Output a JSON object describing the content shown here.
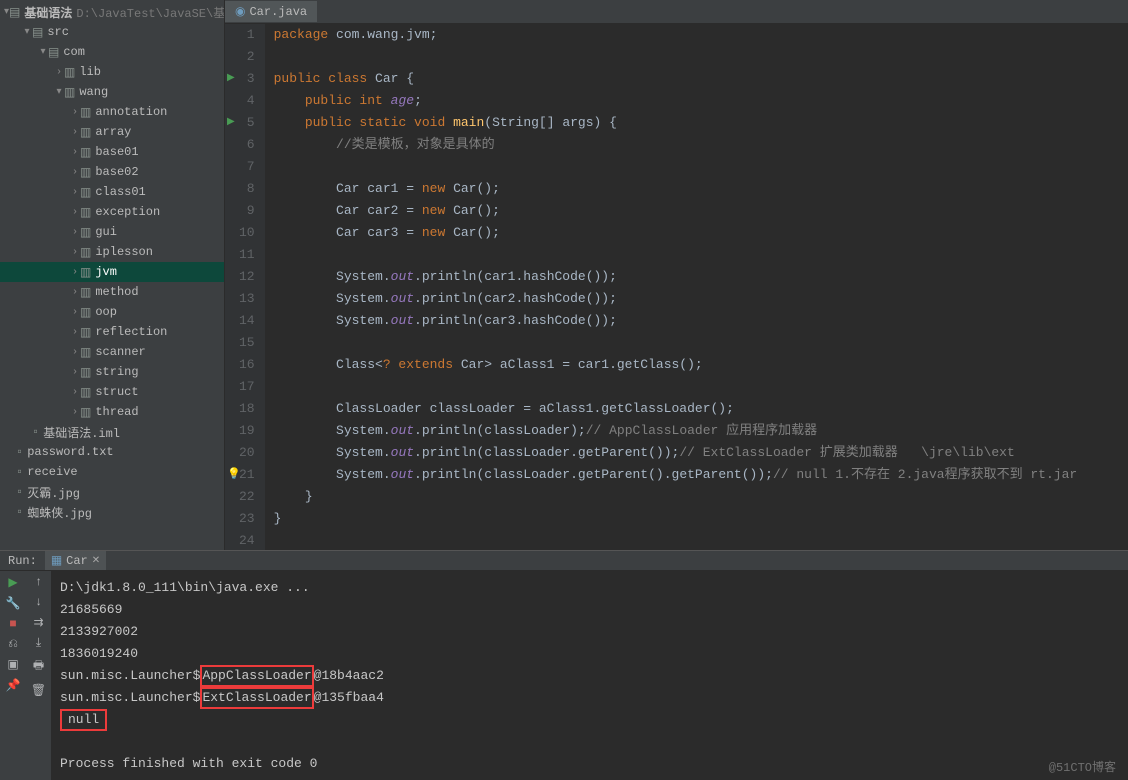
{
  "sidebar": {
    "root": {
      "name": "基础语法",
      "path": "D:\\JavaTest\\JavaSE\\基"
    },
    "items": [
      {
        "indent": 1,
        "arrow": "▾",
        "icon": "folder",
        "label": "src"
      },
      {
        "indent": 2,
        "arrow": "▾",
        "icon": "folder",
        "label": "com"
      },
      {
        "indent": 3,
        "arrow": "›",
        "icon": "package",
        "label": "lib"
      },
      {
        "indent": 3,
        "arrow": "▾",
        "icon": "package",
        "label": "wang"
      },
      {
        "indent": 4,
        "arrow": "›",
        "icon": "package",
        "label": "annotation"
      },
      {
        "indent": 4,
        "arrow": "›",
        "icon": "package",
        "label": "array"
      },
      {
        "indent": 4,
        "arrow": "›",
        "icon": "package",
        "label": "base01"
      },
      {
        "indent": 4,
        "arrow": "›",
        "icon": "package",
        "label": "base02"
      },
      {
        "indent": 4,
        "arrow": "›",
        "icon": "package",
        "label": "class01"
      },
      {
        "indent": 4,
        "arrow": "›",
        "icon": "package",
        "label": "exception"
      },
      {
        "indent": 4,
        "arrow": "›",
        "icon": "package",
        "label": "gui"
      },
      {
        "indent": 4,
        "arrow": "›",
        "icon": "package",
        "label": "iplesson"
      },
      {
        "indent": 4,
        "arrow": "›",
        "icon": "package",
        "label": "jvm",
        "selected": true
      },
      {
        "indent": 4,
        "arrow": "›",
        "icon": "package",
        "label": "method"
      },
      {
        "indent": 4,
        "arrow": "›",
        "icon": "package",
        "label": "oop"
      },
      {
        "indent": 4,
        "arrow": "›",
        "icon": "package",
        "label": "reflection"
      },
      {
        "indent": 4,
        "arrow": "›",
        "icon": "package",
        "label": "scanner"
      },
      {
        "indent": 4,
        "arrow": "›",
        "icon": "package",
        "label": "string"
      },
      {
        "indent": 4,
        "arrow": "›",
        "icon": "package",
        "label": "struct"
      },
      {
        "indent": 4,
        "arrow": "›",
        "icon": "package",
        "label": "thread"
      },
      {
        "indent": 1,
        "arrow": "",
        "icon": "file",
        "label": "基础语法.iml"
      },
      {
        "indent": 0,
        "arrow": "",
        "icon": "file",
        "label": "password.txt"
      },
      {
        "indent": 0,
        "arrow": "",
        "icon": "file",
        "label": "receive"
      },
      {
        "indent": 0,
        "arrow": "",
        "icon": "file",
        "label": "灭霸.jpg"
      },
      {
        "indent": 0,
        "arrow": "",
        "icon": "file",
        "label": "蜘蛛侠.jpg"
      }
    ]
  },
  "editor": {
    "tab_label": "Car.java",
    "lines": [
      {
        "n": 1,
        "html": "<span class='kw'>package</span> com.wang.jvm<span class='punct'>;</span>"
      },
      {
        "n": 2,
        "html": ""
      },
      {
        "n": 3,
        "run": true,
        "html": "<span class='kw'>public class</span> Car <span class='punct'>{</span>"
      },
      {
        "n": 4,
        "html": "    <span class='kw'>public int</span> <span class='field'>age</span><span class='punct'>;</span>"
      },
      {
        "n": 5,
        "run": true,
        "html": "    <span class='kw'>public static void</span> <span class='method'>main</span><span class='punct'>(</span>String<span class='punct'>[]</span> args<span class='punct'>) {</span>"
      },
      {
        "n": 6,
        "html": "        <span class='comment'>//类是模板，对象是具体的</span>"
      },
      {
        "n": 7,
        "html": ""
      },
      {
        "n": 8,
        "html": "        Car car1 <span class='punct'>=</span> <span class='kw'>new</span> Car<span class='punct'>();</span>"
      },
      {
        "n": 9,
        "html": "        Car car2 <span class='punct'>=</span> <span class='kw'>new</span> Car<span class='punct'>();</span>"
      },
      {
        "n": 10,
        "html": "        Car car3 <span class='punct'>=</span> <span class='kw'>new</span> Car<span class='punct'>();</span>"
      },
      {
        "n": 11,
        "html": ""
      },
      {
        "n": 12,
        "html": "        System.<span class='field'>out</span>.println<span class='punct'>(</span>car1.hashCode<span class='punct'>());</span>"
      },
      {
        "n": 13,
        "html": "        System.<span class='field'>out</span>.println<span class='punct'>(</span>car2.hashCode<span class='punct'>());</span>"
      },
      {
        "n": 14,
        "html": "        System.<span class='field'>out</span>.println<span class='punct'>(</span>car3.hashCode<span class='punct'>());</span>"
      },
      {
        "n": 15,
        "html": ""
      },
      {
        "n": 16,
        "html": "        Class&lt;<span class='kw'>? extends</span> Car&gt; aClass1 <span class='punct'>=</span> car1.getClass<span class='punct'>();</span>"
      },
      {
        "n": 17,
        "html": ""
      },
      {
        "n": 18,
        "html": "        ClassLoader classLoader <span class='punct'>=</span> aClass1.getClassLoader<span class='punct'>();</span>"
      },
      {
        "n": 19,
        "html": "        System.<span class='field'>out</span>.println<span class='punct'>(</span>classLoader<span class='punct'>);</span><span class='comment'>// AppClassLoader 应用程序加载器</span>"
      },
      {
        "n": 20,
        "html": "        System.<span class='field'>out</span>.println<span class='punct'>(</span>classLoader.getParent<span class='punct'>());</span><span class='comment'>// ExtClassLoader 扩展类加载器   \\jre\\lib\\ext</span>"
      },
      {
        "n": 21,
        "bulb": true,
        "html": "        System.<span class='field'>out</span>.println<span class='punct'>(</span>classLoader.getParent<span class='punct'>()</span>.getParent<span class='punct'>());</span><span class='comment'>// null 1.不存在 2.java程序获取不到 rt.jar</span>"
      },
      {
        "n": 22,
        "html": "    <span class='punct'>}</span>"
      },
      {
        "n": 23,
        "html": "<span class='punct'>}</span>"
      },
      {
        "n": 24,
        "html": ""
      }
    ]
  },
  "run": {
    "label": "Run:",
    "tab": "Car",
    "output": {
      "line0": "D:\\jdk1.8.0_111\\bin\\java.exe ...",
      "line1": "21685669",
      "line2": "2133927002",
      "line3": "1836019240",
      "line4_pre": "sun.misc.Launcher$",
      "line4_box": "AppClassLoader",
      "line4_post": "@18b4aac2",
      "line5_pre": "sun.misc.Launcher$",
      "line5_box": "ExtClassLoader",
      "line5_post": "@135fbaa4",
      "line6_box": "null",
      "line_blank": "",
      "line7": "Process finished with exit code 0"
    }
  },
  "watermark": "@51CTO博客"
}
